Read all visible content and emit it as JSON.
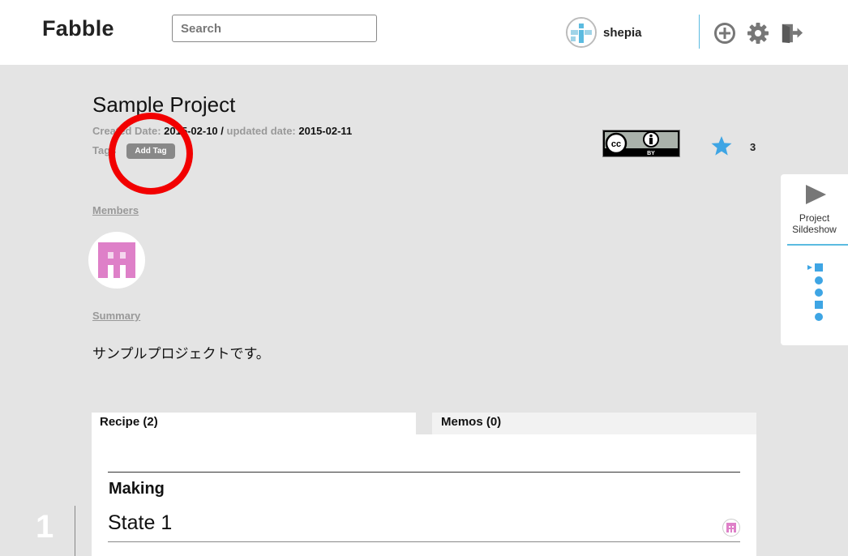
{
  "header": {
    "logo": "Fabble",
    "search_placeholder": "Search",
    "username": "shepia",
    "icons": [
      "add-circle-icon",
      "gear-icon",
      "logout-icon"
    ]
  },
  "project": {
    "title": "Sample Project",
    "created_label": "Created Date:",
    "created_date": "2015-02-10",
    "separator": "/",
    "updated_label": "updated date:",
    "updated_date": "2015-02-11",
    "tags_label": "Tags",
    "add_tag_label": "Add Tag",
    "license": "cc-by-icon",
    "license_by_text": "BY",
    "star_count": "3",
    "members_label": "Members",
    "summary_label": "Summary",
    "summary_text": "サンプルプロジェクトです。"
  },
  "side_panel": {
    "slideshow_label_line1": "Project",
    "slideshow_label_line2": "Sildeshow"
  },
  "tabs": {
    "recipe_label": "Recipe (2)",
    "memos_label": "Memos (0)"
  },
  "recipe": {
    "section_title": "Making",
    "state_title": "State 1",
    "step_number": "1"
  },
  "colors": {
    "accent_blue": "#5bbbe0",
    "highlight_red": "#f20000",
    "avatar_pink": "#de80c8",
    "page_bg": "#e4e4e4"
  }
}
